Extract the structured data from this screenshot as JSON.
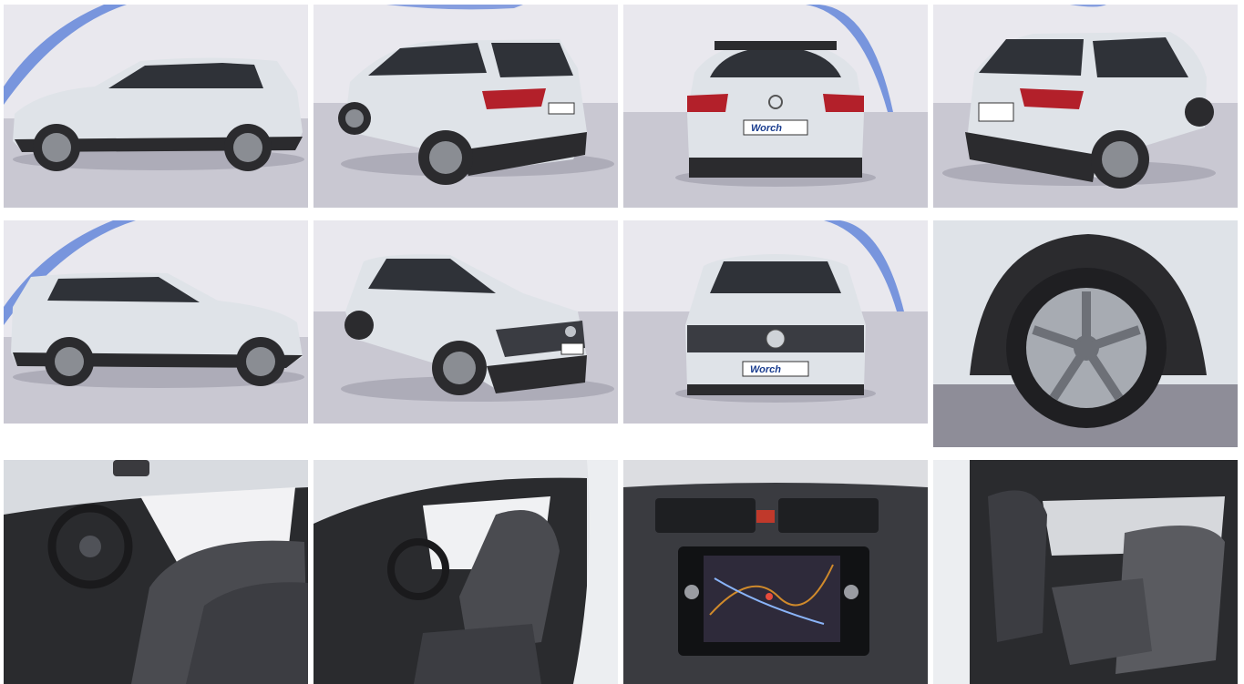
{
  "gallery": {
    "plate_text": "Worch",
    "colors": {
      "studio_wall": "#e9e8ee",
      "studio_floor": "#c9c8d2",
      "studio_arc": "#5b7fd8",
      "car_body": "#dfe3e8",
      "car_shadow": "#2b2b2e",
      "glass": "#2f3238",
      "tail_light": "#b3202a",
      "interior_dark": "#2a2b2e",
      "seat_fabric": "#4a4b50",
      "screen_map": "#2e2a3a"
    },
    "photos": [
      {
        "id": "side-left",
        "icon": "car-side-icon"
      },
      {
        "id": "rear-three-quarter-left",
        "icon": "car-rear-icon"
      },
      {
        "id": "rear",
        "icon": "car-rear-icon"
      },
      {
        "id": "rear-three-quarter-right",
        "icon": "car-rear-icon"
      },
      {
        "id": "side-right",
        "icon": "car-side-icon"
      },
      {
        "id": "front-three-quarter-left",
        "icon": "car-front-icon"
      },
      {
        "id": "front",
        "icon": "car-front-icon"
      },
      {
        "id": "wheel-detail",
        "icon": "wheel-icon"
      },
      {
        "id": "cockpit",
        "icon": "steering-wheel-icon"
      },
      {
        "id": "driver-door-open",
        "icon": "seat-icon"
      },
      {
        "id": "infotainment",
        "icon": "navigation-screen-icon"
      },
      {
        "id": "rear-seats",
        "icon": "seat-icon"
      }
    ]
  }
}
